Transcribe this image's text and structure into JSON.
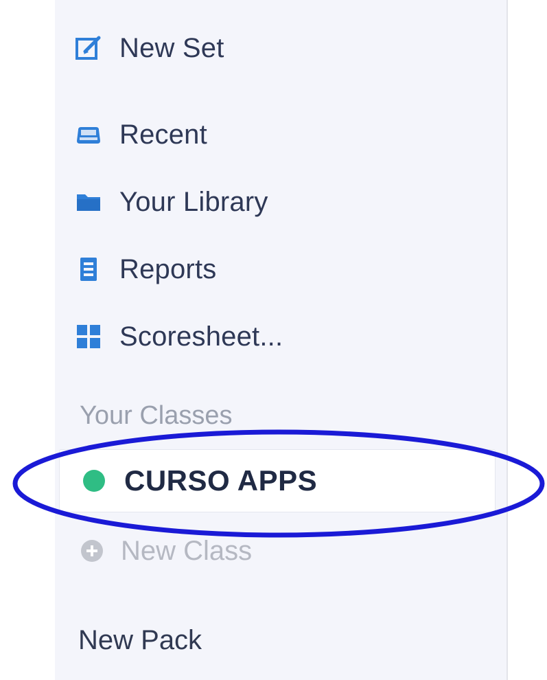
{
  "nav": {
    "items": [
      {
        "label": "New Set",
        "icon": "edit-icon"
      },
      {
        "label": "Recent",
        "icon": "recent-icon"
      },
      {
        "label": "Your Library",
        "icon": "folder-icon"
      },
      {
        "label": "Reports",
        "icon": "reports-icon"
      },
      {
        "label": "Scoresheet...",
        "icon": "grid-icon"
      }
    ]
  },
  "classes": {
    "header": "Your Classes",
    "items": [
      {
        "label": "CURSO APPS",
        "color": "#2fbd84"
      }
    ],
    "new_class_label": "New Class"
  },
  "new_pack_label": "New Pack",
  "colors": {
    "icon_blue": "#2f7fd8",
    "highlight_ring": "#1a1ad6"
  }
}
